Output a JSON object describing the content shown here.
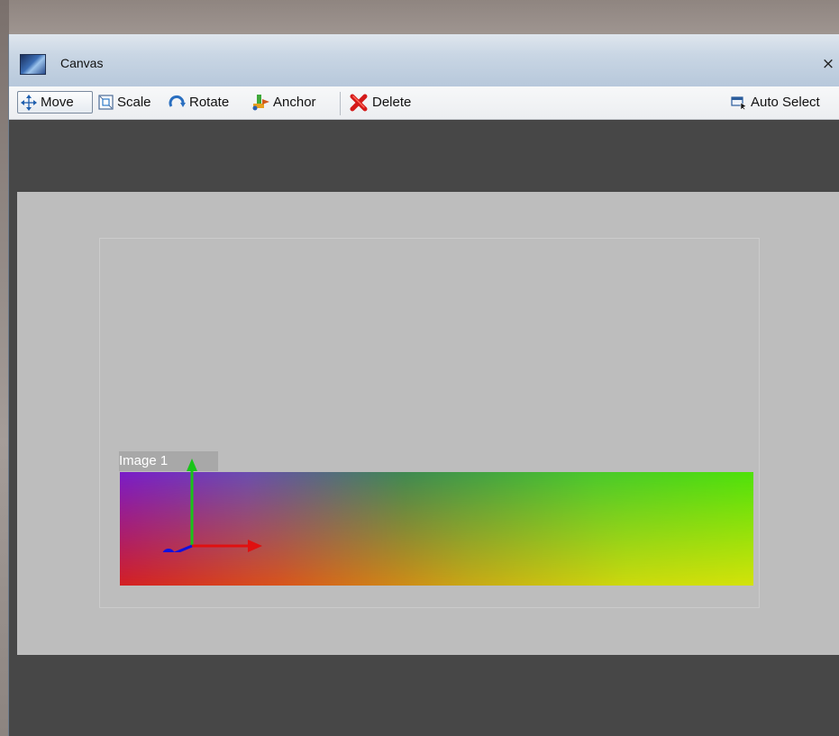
{
  "window": {
    "title": "Canvas",
    "icon": "canvas-window-icon",
    "close_glyph": "×"
  },
  "toolbar": {
    "move_label": "Move",
    "scale_label": "Scale",
    "rotate_label": "Rotate",
    "anchor_label": "Anchor",
    "delete_label": "Delete",
    "auto_select_label": "Auto Select",
    "active_tool": "Move",
    "icons": {
      "move": "move-arrows-icon",
      "scale": "scale-icon",
      "rotate": "rotate-icon",
      "anchor": "anchor-icon",
      "delete": "delete-x-icon",
      "auto_select": "auto-select-icon"
    }
  },
  "canvas": {
    "image_label": "Image 1",
    "colors": {
      "background": "#474747",
      "stage": "#bdbdbd",
      "gizmo_x": "#e01010",
      "gizmo_y": "#19c419",
      "gizmo_z": "#1010e0"
    }
  }
}
